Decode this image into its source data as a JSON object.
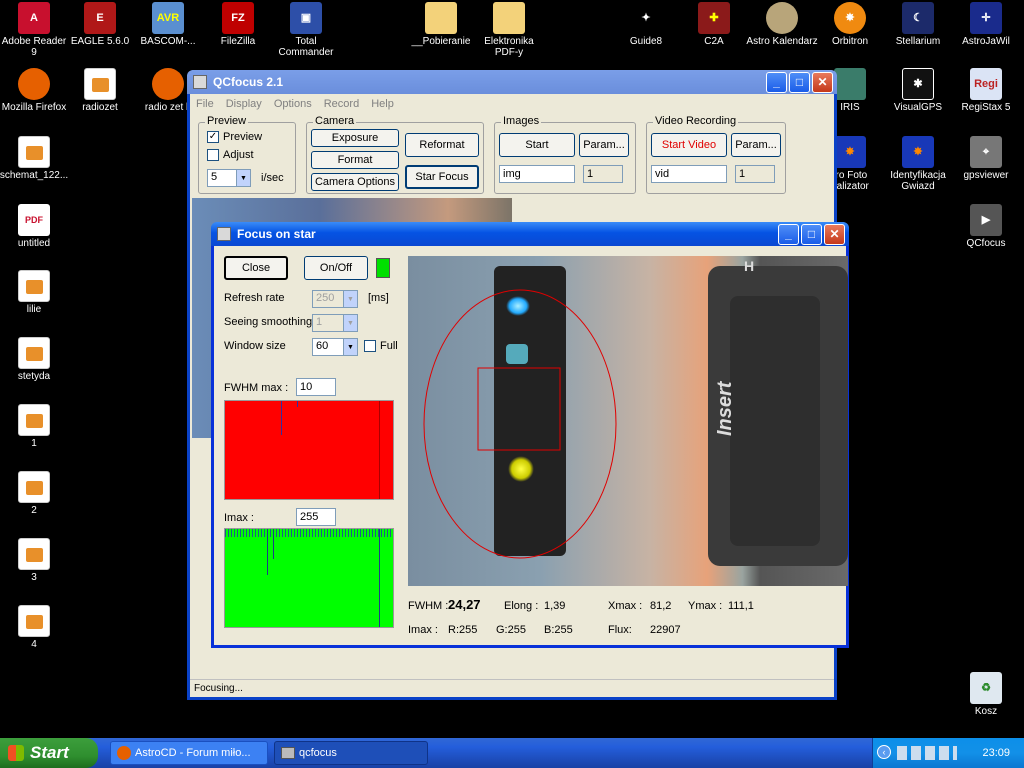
{
  "desktop": {
    "left_icons": [
      {
        "label": "Adobe Reader 9",
        "icon": "pdf-icon"
      },
      {
        "label": "EAGLE 5.6.0",
        "icon": "eagle-icon"
      },
      {
        "label": "BASCOM-...",
        "icon": "avr-icon"
      },
      {
        "label": "FileZilla",
        "icon": "filezilla-icon"
      },
      {
        "label": "Total Commander",
        "icon": "floppy-icon"
      },
      {
        "label": "__Pobieranie",
        "icon": "folder-icon"
      },
      {
        "label": "Elektronika PDF-y",
        "icon": "folder-icon"
      },
      {
        "label": "Guide8",
        "icon": "stars-icon"
      },
      {
        "label": "C2A",
        "icon": "c2a-icon"
      },
      {
        "label": "Astro Kalendarz",
        "icon": "planet-icon"
      },
      {
        "label": "Orbitron",
        "icon": "orbitron-icon"
      },
      {
        "label": "Stellarium",
        "icon": "moon-icon"
      },
      {
        "label": "AstroJaWil",
        "icon": "astro-icon"
      },
      {
        "label": "Mozilla Firefox",
        "icon": "firefox-icon"
      },
      {
        "label": "radiozet",
        "icon": "doc-icon"
      },
      {
        "label": "radio zet k",
        "icon": "firefox-icon"
      },
      {
        "label": "IRIS",
        "icon": "iris-icon"
      },
      {
        "label": "VisualGPS",
        "icon": "gps-icon"
      },
      {
        "label": "RegiStax 5",
        "icon": "registax-icon"
      },
      {
        "label": "schemat_122...",
        "icon": "doc-icon"
      },
      {
        "label": "tro Foto nalizator",
        "icon": "foto-icon"
      },
      {
        "label": "Identyfikacja Gwiazd",
        "icon": "star-id-icon"
      },
      {
        "label": "gpsviewer",
        "icon": "satellite-icon"
      },
      {
        "label": "untitled",
        "icon": "pdf-doc-icon"
      },
      {
        "label": "QCfocus",
        "icon": "camera-icon"
      },
      {
        "label": "lilie",
        "icon": "doc-icon"
      },
      {
        "label": "stetyda",
        "icon": "doc-icon"
      },
      {
        "label": "1",
        "icon": "doc-icon"
      },
      {
        "label": "2",
        "icon": "doc-icon"
      },
      {
        "label": "3",
        "icon": "doc-icon"
      },
      {
        "label": "4",
        "icon": "doc-icon"
      },
      {
        "label": "Kosz",
        "icon": "recycle-bin-icon"
      }
    ]
  },
  "qcfocus": {
    "title": "QCfocus 2.1",
    "menu": [
      "File",
      "Display",
      "Options",
      "Record",
      "Help"
    ],
    "preview": {
      "group": "Preview",
      "preview_label": "Preview",
      "adjust_label": "Adjust",
      "rate_value": "5",
      "rate_unit": "i/sec"
    },
    "camera": {
      "group": "Camera",
      "exposure": "Exposure",
      "format": "Format",
      "options": "Camera Options",
      "reformat": "Reformat",
      "star_focus": "Star Focus"
    },
    "images": {
      "group": "Images",
      "start": "Start",
      "param": "Param...",
      "name": "img",
      "count": "1"
    },
    "video": {
      "group": "Video Recording",
      "start": "Start Video",
      "param": "Param...",
      "name": "vid",
      "count": "1"
    },
    "status": "Focusing..."
  },
  "focus": {
    "title": "Focus on star",
    "close": "Close",
    "onoff": "On/Off",
    "refresh_label": "Refresh rate",
    "refresh_value": "250",
    "refresh_unit": "[ms]",
    "seeing_label": "Seeing smoothing",
    "seeing_value": "1",
    "window_label": "Window size",
    "window_value": "60",
    "full_label": "Full",
    "fwhm_max_label": "FWHM max :",
    "fwhm_max_value": "10",
    "imax_label": "Imax :",
    "imax_value": "255",
    "fwhm_label": "FWHM :",
    "fwhm_value": "24,27",
    "elong_label": "Elong :",
    "elong_value": "1,39",
    "xmax_label": "Xmax :",
    "xmax_value": "81,2",
    "ymax_label": "Ymax :",
    "ymax_value": "111,1",
    "imax2_label": "Imax :",
    "r_value": "R:255",
    "g_value": "G:255",
    "b_value": "B:255",
    "flux_label": "Flux:",
    "flux_value": "22907",
    "insert_key": "Insert",
    "h_key": "H"
  },
  "taskbar": {
    "start": "Start",
    "tasks": [
      "AstroCD - Forum miło...",
      "qcfocus"
    ],
    "clock": "23:09"
  },
  "colors": {
    "indicator": "#00e000",
    "fwhm_plot": "#ff0000",
    "imax_plot": "#00ff00",
    "video_start": "#e00000"
  }
}
